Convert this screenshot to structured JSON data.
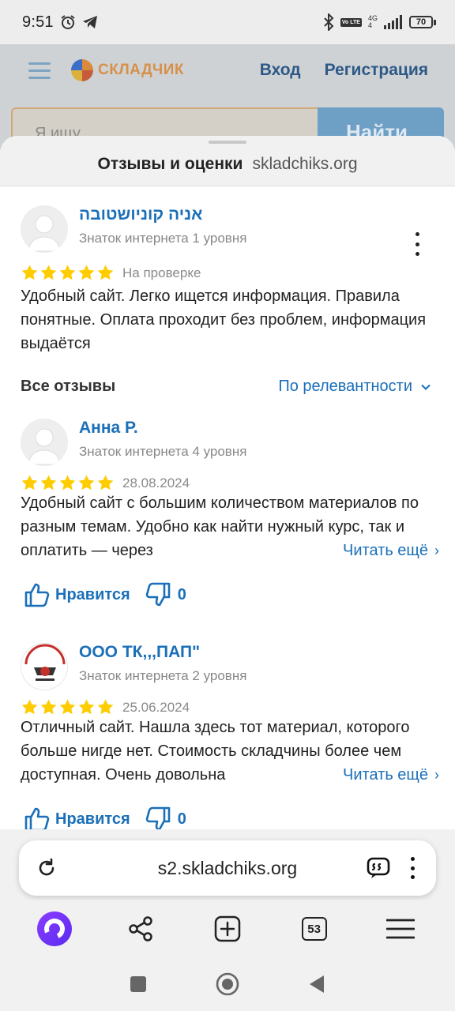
{
  "status_bar": {
    "time": "9:51",
    "left_icons": [
      "alarm-icon",
      "telegram-icon"
    ],
    "right_icons": [
      "bluetooth-icon",
      "volte-icon",
      "signal-icon"
    ],
    "volte": "Vo LTE",
    "network": "4G",
    "network_sub": "4",
    "battery": "70"
  },
  "site_header": {
    "logo_text": "СКЛАДЧИК",
    "login": "Вход",
    "register": "Регистрация",
    "search_placeholder": "Я ищу...",
    "search_button": "Найти"
  },
  "sheet": {
    "title": "Отзывы и оценки",
    "domain": "skladchiks.org"
  },
  "my_review": {
    "author": "אניה קוניושטובה",
    "level": "Знаток интернета 1 уровня",
    "rating": 5,
    "status": "На проверке",
    "text": "Удобный сайт.  Легко ищется информация. Правила понятные. Оплата проходит без проблем, информация выдаётся"
  },
  "all_reviews": {
    "title": "Все отзывы",
    "sort": "По релевантности"
  },
  "reviews": [
    {
      "author": "Анна Р.",
      "level": "Знаток интернета 4 уровня",
      "rating": 5,
      "date": "28.08.2024",
      "text": "Удобный сайт с большим количеством материалов по разным темам. Удобно как найти нужный курс, так и оплатить — через",
      "more": "Читать ещё",
      "like_label": "Нравится",
      "dislike_count": "0"
    },
    {
      "author": "ООО ТК,,,ПАП\"",
      "level": "Знаток интернета 2 уровня",
      "rating": 5,
      "date": "25.06.2024",
      "text": "Отличный сайт. Нашла здесь тот материал, которого больше нигде нет. Стоимость складчины более чем доступная. Очень довольна",
      "more": "Читать ещё",
      "like_label": "Нравится",
      "dislike_count": "0"
    }
  ],
  "browser": {
    "url": "s2.skladchiks.org",
    "tabs_count": "53",
    "toolbar_icons": [
      "alice-icon",
      "share-icon",
      "new-tab-icon",
      "tabs-icon",
      "menu-icon"
    ]
  },
  "colors": {
    "link": "#1a6fb8",
    "star": "#ffcc00",
    "alice": "#7b3cff"
  }
}
